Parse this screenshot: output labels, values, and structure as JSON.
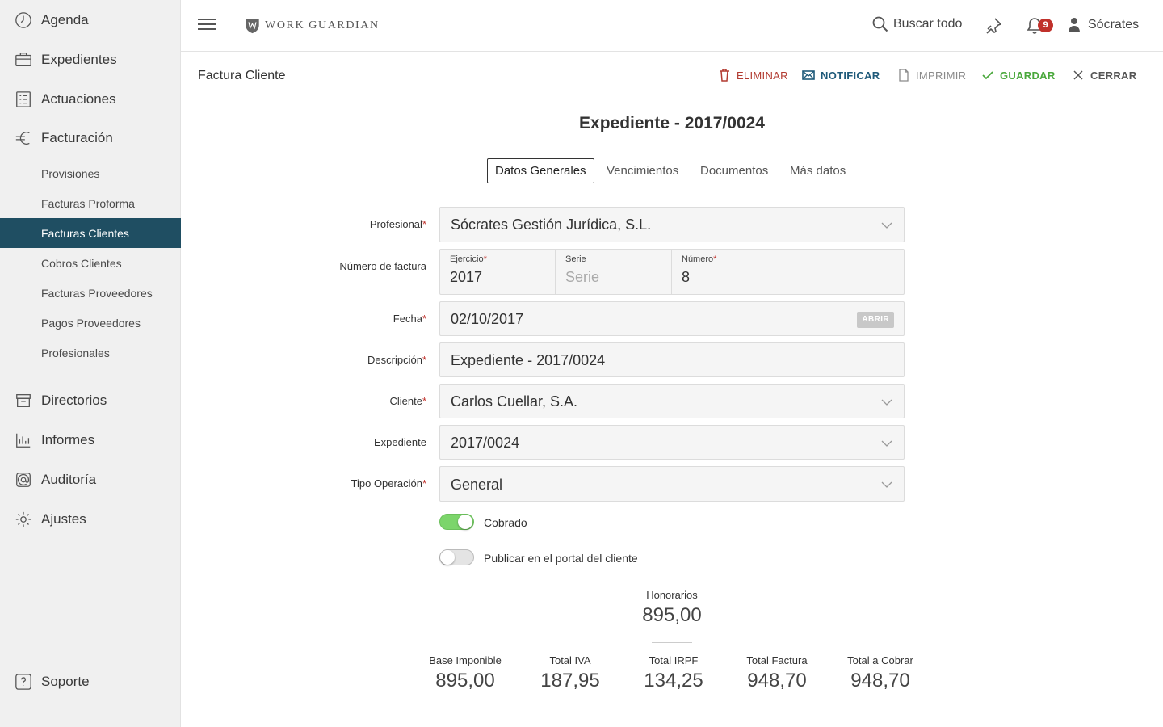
{
  "sidebar": {
    "main_top": [
      {
        "label": "Agenda",
        "icon": "clock-icon"
      },
      {
        "label": "Expedientes",
        "icon": "briefcase-icon"
      },
      {
        "label": "Actuaciones",
        "icon": "checklist-icon"
      },
      {
        "label": "Facturación",
        "icon": "euro-icon"
      }
    ],
    "sub": [
      {
        "label": "Provisiones"
      },
      {
        "label": "Facturas Proforma"
      },
      {
        "label": "Facturas Clientes",
        "active": true
      },
      {
        "label": "Cobros Clientes"
      },
      {
        "label": "Facturas Proveedores"
      },
      {
        "label": "Pagos Proveedores"
      },
      {
        "label": "Profesionales"
      }
    ],
    "main_bottom": [
      {
        "label": "Directorios",
        "icon": "archive-icon"
      },
      {
        "label": "Informes",
        "icon": "bar-chart-icon"
      },
      {
        "label": "Auditoría",
        "icon": "at-badge-icon"
      },
      {
        "label": "Ajustes",
        "icon": "gear-icon"
      }
    ],
    "support": {
      "label": "Soporte",
      "icon": "question-icon"
    },
    "active_color": "#1f4e62"
  },
  "header": {
    "brand": "WORK GUARDIAN",
    "search_label": "Buscar todo",
    "notifications_count": "9",
    "user_name": "Sócrates"
  },
  "toolbar": {
    "page_title": "Factura Cliente",
    "eliminar": "ELIMINAR",
    "notificar": "NOTIFICAR",
    "imprimir": "IMPRIMIR",
    "guardar": "GUARDAR",
    "cerrar": "CERRAR"
  },
  "document": {
    "title": "Expediente - 2017/0024",
    "tabs": [
      "Datos Generales",
      "Vencimientos",
      "Documentos",
      "Más datos"
    ],
    "active_tab": "Datos Generales"
  },
  "form": {
    "profesional": {
      "label": "Profesional",
      "value": "Sócrates Gestión Jurídica, S.L."
    },
    "numero_factura": {
      "label": "Número de factura",
      "ejercicio_label": "Ejercicio",
      "ejercicio_value": "2017",
      "serie_label": "Serie",
      "serie_placeholder": "Serie",
      "numero_label": "Número",
      "numero_value": "8"
    },
    "fecha": {
      "label": "Fecha",
      "value": "02/10/2017",
      "open_label": "ABRIR"
    },
    "descripcion": {
      "label": "Descripción",
      "value": "Expediente - 2017/0024"
    },
    "cliente": {
      "label": "Cliente",
      "value": "Carlos Cuellar, S.A."
    },
    "expediente": {
      "label": "Expediente",
      "value": "2017/0024"
    },
    "tipo_operacion": {
      "label": "Tipo Operación",
      "value": "General"
    },
    "cobrado": {
      "label": "Cobrado",
      "on": true
    },
    "publicar": {
      "label": "Publicar en el portal del cliente",
      "on": false
    }
  },
  "totals": {
    "honorarios": {
      "label": "Honorarios",
      "value": "895,00"
    },
    "base_imponible": {
      "label": "Base Imponible",
      "value": "895,00"
    },
    "total_iva": {
      "label": "Total IVA",
      "value": "187,95"
    },
    "total_irpf": {
      "label": "Total IRPF",
      "value": "134,25"
    },
    "total_factura": {
      "label": "Total Factura",
      "value": "948,70"
    },
    "total_cobrar": {
      "label": "Total a Cobrar",
      "value": "948,70"
    }
  }
}
